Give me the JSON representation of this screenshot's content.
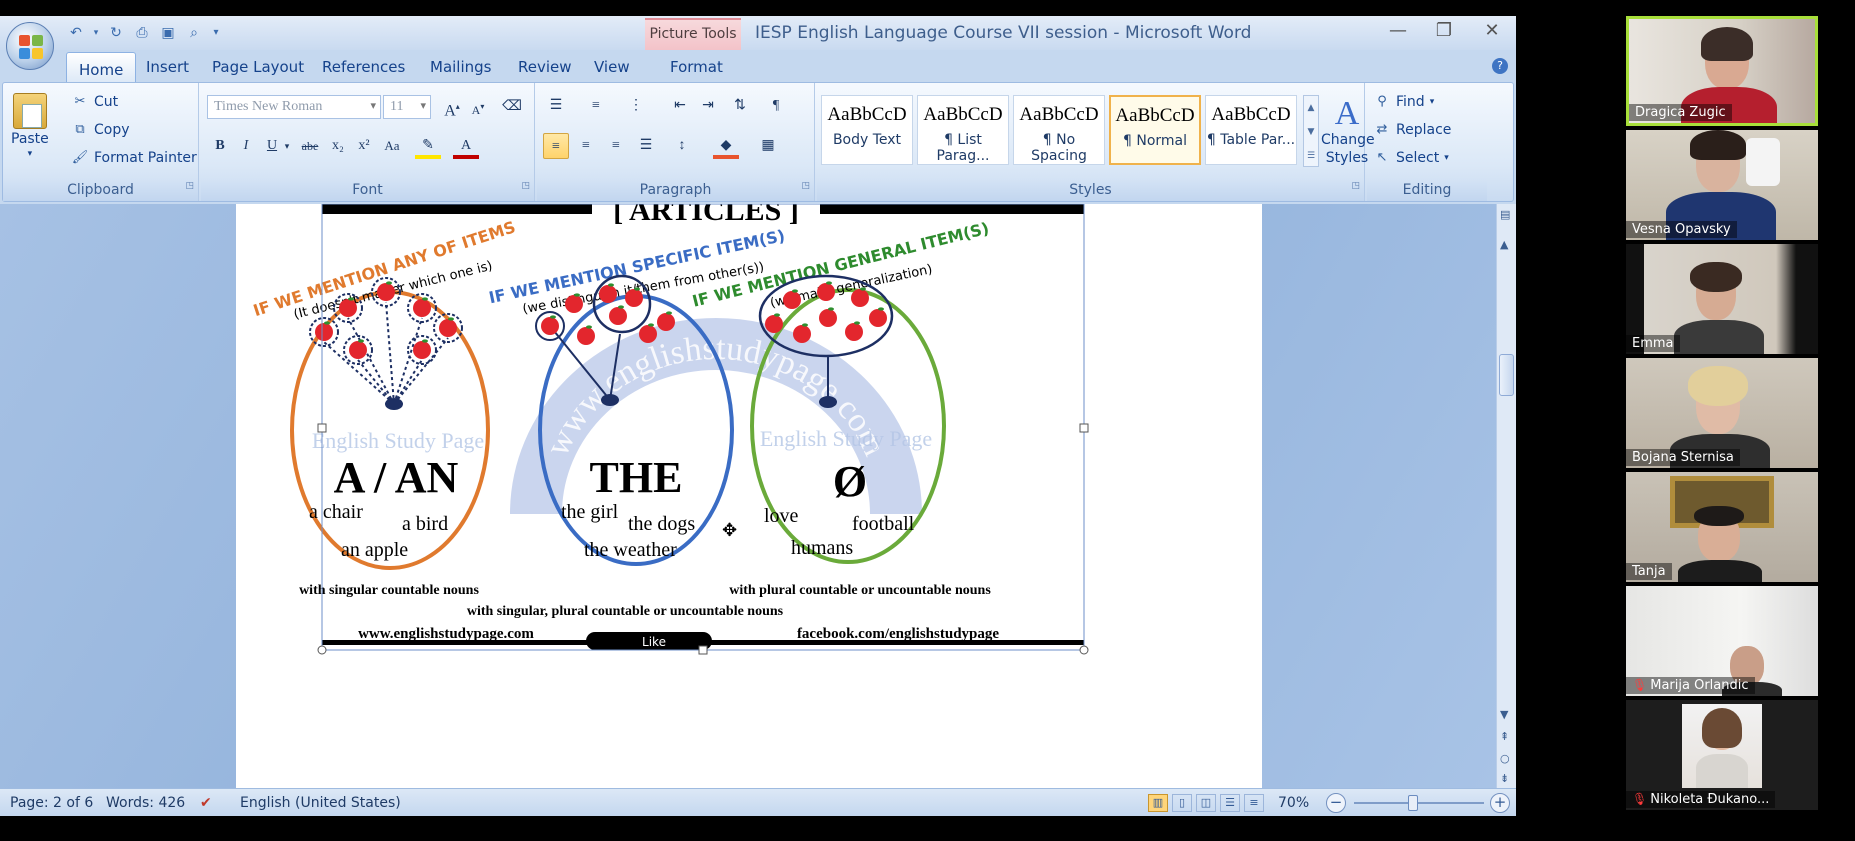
{
  "window": {
    "title": "IESP English Language Course VII session - Microsoft Word",
    "context_tab": "Picture Tools"
  },
  "tabs": [
    "Home",
    "Insert",
    "Page Layout",
    "References",
    "Mailings",
    "Review",
    "View",
    "Format"
  ],
  "clipboard": {
    "paste": "Paste",
    "cut": "Cut",
    "copy": "Copy",
    "format_painter": "Format Painter",
    "label": "Clipboard"
  },
  "font": {
    "name": "Times New Roman",
    "size": "11",
    "label": "Font",
    "bold": "B",
    "italic": "I",
    "underline": "U",
    "strike": "abe",
    "sub": "x₂",
    "sup": "x²",
    "case": "Aa",
    "grow": "A",
    "shrink": "A",
    "color_letter": "A"
  },
  "paragraph": {
    "label": "Paragraph"
  },
  "styles": {
    "label": "Styles",
    "change": "Change Styles",
    "items": [
      {
        "sample": "AaBbCcD",
        "name": "Body Text"
      },
      {
        "sample": "AaBbCcD",
        "name": "¶ List Parag..."
      },
      {
        "sample": "AaBbCcD",
        "name": "¶ No Spacing"
      },
      {
        "sample": "AaBbCcD",
        "name": "¶ Normal"
      },
      {
        "sample": "AaBbCcD",
        "name": "¶ Table Par..."
      }
    ],
    "selected": 3
  },
  "editing": {
    "find": "Find",
    "replace": "Replace",
    "select": "Select",
    "label": "Editing"
  },
  "status": {
    "page": "Page: 2 of 6",
    "words": "Words: 426",
    "language": "English (United States)",
    "zoom": "70%"
  },
  "infographic": {
    "title": "[ ARTICLES ]",
    "watermark_left": "English Study Page",
    "watermark_right": "English Study Page",
    "watermark_arc": "www.englishstudypage.com",
    "col1": {
      "heading": "IF WE MENTION ANY OF ITEMS",
      "sub": "(It doesn't matter which one is)",
      "article": "A / AN",
      "w1": "a chair",
      "w2": "a bird",
      "w3": "an apple",
      "note": "with singular countable nouns",
      "color": "#e07a2e"
    },
    "col2": {
      "heading": "IF WE MENTION SPECIFIC ITEM(S)",
      "sub": "(we distinguish it/them from other(s))",
      "article": "THE",
      "w1": "the girl",
      "w2": "the dogs",
      "w3": "the weather",
      "note": "with singular, plural countable or uncountable nouns",
      "color": "#3a6cc4"
    },
    "col3": {
      "heading": "IF WE MENTION GENERAL ITEM(S)",
      "sub": "(we make generalization)",
      "article": "Ø",
      "w1": "love",
      "w2": "football",
      "w3": "humans",
      "note": "with plural countable or uncountable nouns",
      "color": "#2e8b2e"
    },
    "footer_left": "www.englishstudypage.com",
    "footer_like": "Like",
    "footer_right": "facebook.com/englishstudypage"
  },
  "participants": [
    {
      "name": "Dragica Zugic",
      "muted": false,
      "active": true
    },
    {
      "name": "Vesna Opavsky",
      "muted": false,
      "active": false
    },
    {
      "name": "Emma",
      "muted": false,
      "active": false
    },
    {
      "name": "Bojana Sternisa",
      "muted": false,
      "active": false
    },
    {
      "name": "Tanja",
      "muted": false,
      "active": false
    },
    {
      "name": "Marija Orlandic",
      "muted": true,
      "active": false
    },
    {
      "name": "Nikoleta Đukano...",
      "muted": true,
      "active": false
    }
  ],
  "colors": {
    "ribbon": "#dbe8f7",
    "accent": "#15428b",
    "apple": "#e3262d",
    "active_border": "#a8df3a"
  }
}
